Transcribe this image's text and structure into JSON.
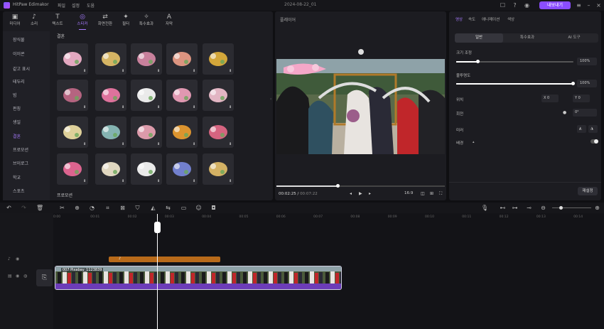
{
  "app": {
    "name": "HitPaw Edimakor",
    "project_title": "2024-08-22_01",
    "export_label": "내보내기"
  },
  "menu": [
    "파일",
    "설정",
    "도움"
  ],
  "categories": [
    {
      "label": "미디어",
      "icon": "media-icon"
    },
    {
      "label": "소리",
      "icon": "music-icon"
    },
    {
      "label": "텍스트",
      "icon": "text-icon"
    },
    {
      "label": "스티커",
      "icon": "sticker-icon",
      "active": true
    },
    {
      "label": "화면전환",
      "icon": "transition-icon"
    },
    {
      "label": "필터",
      "icon": "filter-icon"
    },
    {
      "label": "특수효과",
      "icon": "effects-icon"
    },
    {
      "label": "자막",
      "icon": "subtitle-icon"
    }
  ],
  "sidebar": {
    "items": [
      {
        "label": "장식물"
      },
      {
        "label": "이이콘"
      },
      {
        "label": "같고 표시"
      },
      {
        "label": "테두리"
      },
      {
        "label": "빔"
      },
      {
        "label": "펀칭"
      },
      {
        "label": "생일"
      },
      {
        "label": "결혼",
        "active": true
      },
      {
        "label": "프로모션"
      },
      {
        "label": "브이로그"
      },
      {
        "label": "학교"
      },
      {
        "label": "스포츠"
      }
    ]
  },
  "sticker_grid": {
    "section_title": "결혼",
    "next_section_title": "프로모션",
    "stickers": [
      {
        "name": "floral-banner"
      },
      {
        "name": "floral-wreath"
      },
      {
        "name": "ribbon-gift"
      },
      {
        "name": "bells-bouquet"
      },
      {
        "name": "golden-bells"
      },
      {
        "name": "rose-bouquet"
      },
      {
        "name": "pink-heels"
      },
      {
        "name": "floral-card"
      },
      {
        "name": "pink-ribbon-banner"
      },
      {
        "name": "just-married-banner"
      },
      {
        "name": "flower-scatter"
      },
      {
        "name": "wedding-car"
      },
      {
        "name": "flower-bunch"
      },
      {
        "name": "toast-glasses"
      },
      {
        "name": "single-rose"
      },
      {
        "name": "wedding-cake"
      },
      {
        "name": "white-rose"
      },
      {
        "name": "wedding-dress"
      },
      {
        "name": "candle-flowers"
      },
      {
        "name": "champagne"
      }
    ]
  },
  "player": {
    "title": "플레이어",
    "time_current": "00:02:25",
    "time_total": "00:07:22",
    "aspect": "16:9",
    "progress": 0.36
  },
  "properties": {
    "tabs": [
      {
        "label": "영상",
        "active": true
      },
      {
        "label": "속도"
      },
      {
        "label": "애니메이션"
      },
      {
        "label": "색상"
      }
    ],
    "segments": [
      {
        "label": "일반",
        "active": true
      },
      {
        "label": "특수효과"
      },
      {
        "label": "AI 도구"
      }
    ],
    "scale": {
      "label": "크기 조정",
      "value": "100%",
      "fraction": 0.18
    },
    "opacity": {
      "label": "불투명도",
      "value": "100%",
      "fraction": 1.0
    },
    "position": {
      "label": "위치",
      "x_label": "X",
      "x_value": "0",
      "y_label": "Y",
      "y_value": "0"
    },
    "rotation": {
      "label": "회전",
      "value": "0°"
    },
    "mirror": {
      "label": "미러"
    },
    "background": {
      "label": "배경"
    },
    "reset_label": "재설정"
  },
  "timeline": {
    "ticks": [
      "0:00",
      "00:01",
      "00:02",
      "00:03",
      "00:04",
      "00:05",
      "00:06",
      "00:07",
      "00:08",
      "00:09",
      "00:10",
      "00:11",
      "00:12",
      "00:13",
      "00:14"
    ],
    "clip_label": "007 Pixabay_1123839",
    "audio_label": "♪"
  },
  "colors": {
    "accent": "#a77bff",
    "export": "#8a4dff",
    "audio_clip": "#b86a1a",
    "video_strip": "#6c3cb8"
  }
}
